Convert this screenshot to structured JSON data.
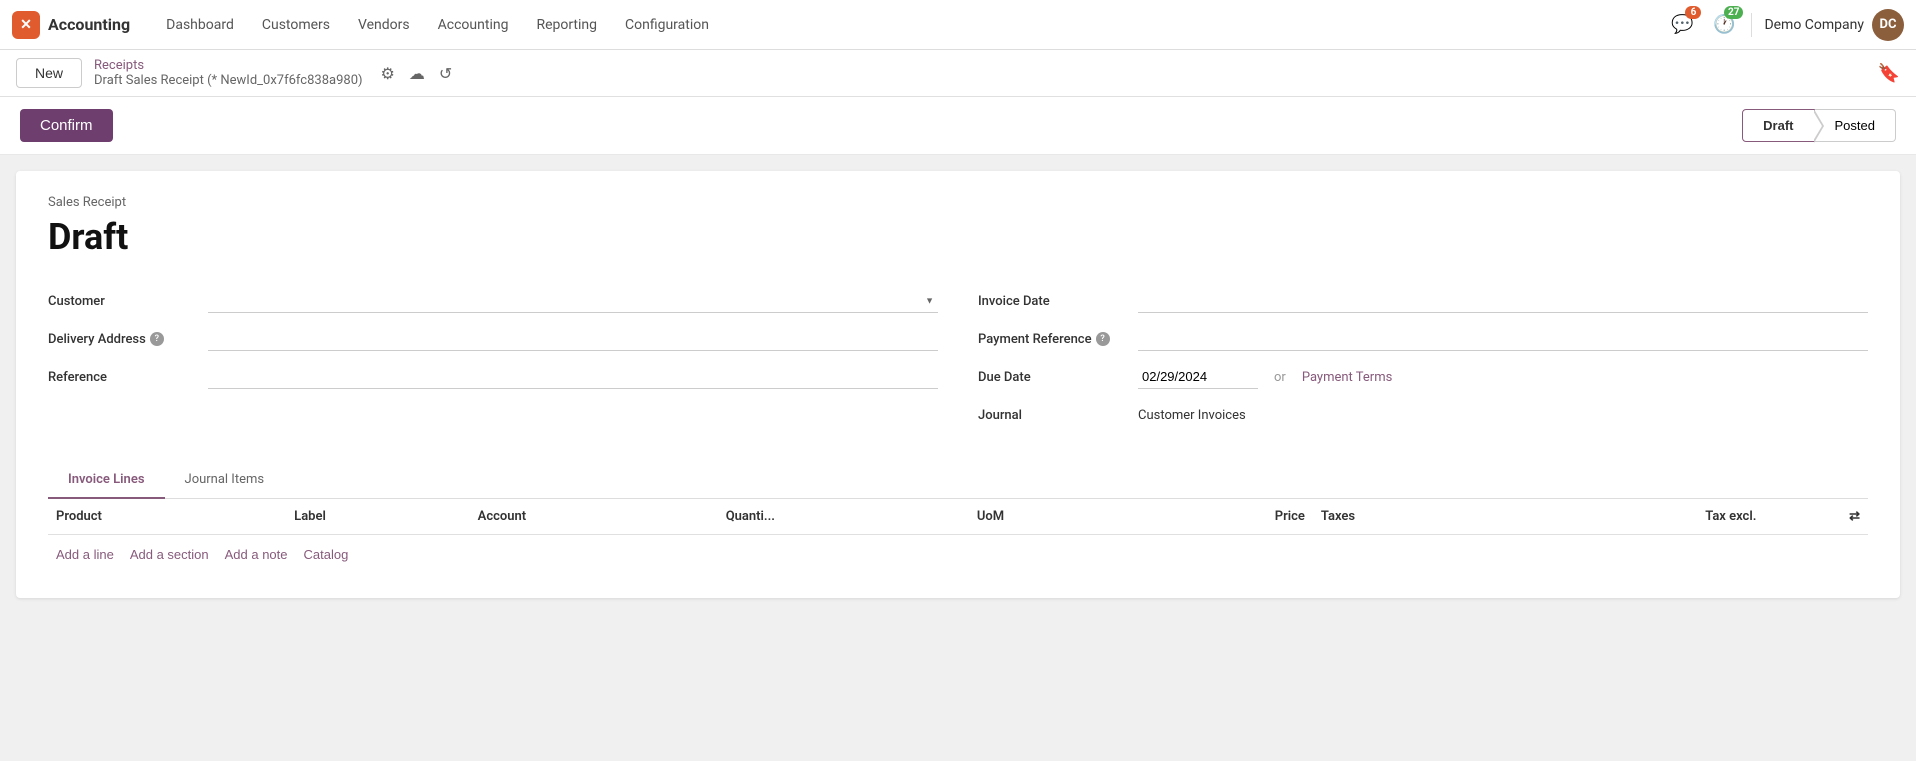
{
  "brand": {
    "icon_text": "✕",
    "name": "Accounting"
  },
  "topnav": {
    "items": [
      {
        "id": "dashboard",
        "label": "Dashboard"
      },
      {
        "id": "customers",
        "label": "Customers"
      },
      {
        "id": "vendors",
        "label": "Vendors"
      },
      {
        "id": "accounting",
        "label": "Accounting"
      },
      {
        "id": "reporting",
        "label": "Reporting"
      },
      {
        "id": "configuration",
        "label": "Configuration"
      }
    ]
  },
  "notifications": {
    "chat_count": "6",
    "activity_count": "27"
  },
  "user": {
    "name": "Demo Company",
    "avatar_text": "DC"
  },
  "toolbar": {
    "new_label": "New",
    "breadcrumb_parent": "Receipts",
    "breadcrumb_current": "Draft Sales Receipt (* NewId_0x7f6fc838a980)",
    "icons": [
      "⚙",
      "☁",
      "↺"
    ]
  },
  "actionbar": {
    "confirm_label": "Confirm",
    "status_draft": "Draft",
    "status_posted": "Posted"
  },
  "form": {
    "subtitle": "Sales Receipt",
    "title": "Draft",
    "left": {
      "customer_label": "Customer",
      "customer_placeholder": "",
      "delivery_address_label": "Delivery Address",
      "delivery_address_help": "?",
      "reference_label": "Reference"
    },
    "right": {
      "invoice_date_label": "Invoice Date",
      "invoice_date_value": "",
      "payment_reference_label": "Payment Reference",
      "payment_reference_help": "?",
      "payment_reference_value": "",
      "due_date_label": "Due Date",
      "due_date_value": "02/29/2024",
      "or_text": "or",
      "payment_terms_label": "Payment Terms",
      "journal_label": "Journal",
      "journal_value": "Customer Invoices"
    }
  },
  "tabs": {
    "items": [
      {
        "id": "invoice-lines",
        "label": "Invoice Lines",
        "active": true
      },
      {
        "id": "journal-items",
        "label": "Journal Items",
        "active": false
      }
    ]
  },
  "table": {
    "columns": [
      {
        "id": "product",
        "label": "Product",
        "align": "left"
      },
      {
        "id": "label",
        "label": "Label",
        "align": "left"
      },
      {
        "id": "account",
        "label": "Account",
        "align": "left"
      },
      {
        "id": "quantity",
        "label": "Quanti...",
        "align": "left"
      },
      {
        "id": "uom",
        "label": "UoM",
        "align": "left"
      },
      {
        "id": "price",
        "label": "Price",
        "align": "right"
      },
      {
        "id": "taxes",
        "label": "Taxes",
        "align": "left"
      },
      {
        "id": "tax_excl",
        "label": "Tax excl.",
        "align": "right"
      },
      {
        "id": "arrows",
        "label": "⇄",
        "align": "right"
      }
    ],
    "rows": []
  },
  "add_actions": {
    "add_line": "Add a line",
    "add_section": "Add a section",
    "add_note": "Add a note",
    "catalog": "Catalog"
  }
}
